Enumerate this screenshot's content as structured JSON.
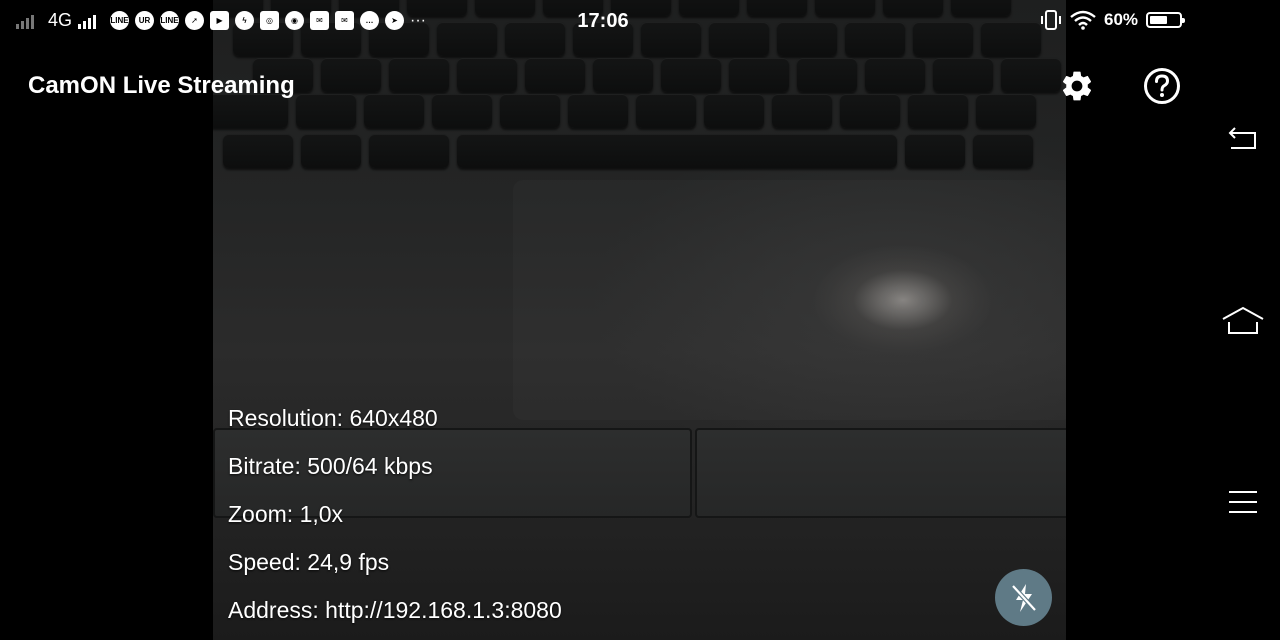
{
  "status_bar": {
    "network": "4G",
    "time": "17:06",
    "battery": "60%",
    "battery_level": 0.6,
    "notification_icons": [
      "line-icon",
      "line-ur-icon",
      "line-icon",
      "compass-icon",
      "youtube-icon",
      "messenger-icon",
      "instagram-icon",
      "chrome-icon",
      "mail-icon",
      "email-icon",
      "chat-icon",
      "telegram-icon"
    ],
    "more": "···"
  },
  "app": {
    "title": "CamON Live Streaming",
    "settings_icon": "gear-icon",
    "help_icon": "help-icon"
  },
  "stream_info": {
    "resolution": "Resolution: 640x480",
    "bitrate": "Bitrate: 500/64 kbps",
    "zoom": "Zoom: 1,0x",
    "speed": "Speed: 24,9 fps",
    "address": "Address: http://192.168.1.3:8080"
  },
  "flash_button": {
    "icon": "flash-off-icon",
    "color": "#5f7a86"
  },
  "nav": {
    "back": "back-icon",
    "home": "home-icon",
    "menu": "menu-icon"
  }
}
